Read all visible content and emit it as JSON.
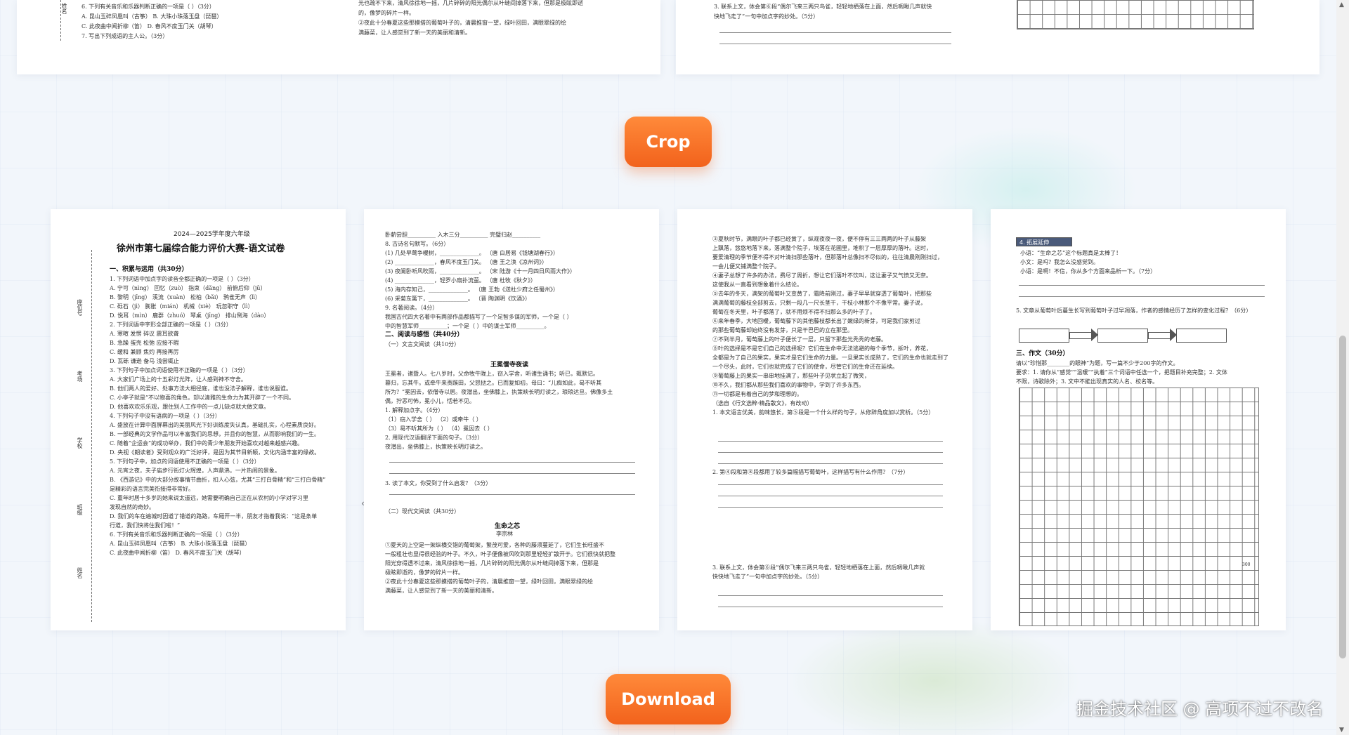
{
  "buttons": {
    "crop_label": "Crop",
    "download_label": "Download"
  },
  "watermark": "掘金技术社区 @ 高项不过不改名",
  "top_left_sheet": {
    "side_name": "姓名",
    "lines": [
      "6. 下列有关音乐和乐器判断正确的一项是（      ）（3分）",
      "A. 昆山玉碎凤凰叫（古筝）        B. 大珠小珠落玉盘（琵琶）",
      "C. 此夜曲中闻折柳（笛）          D. 春风不度玉门关（胡琴）",
      "7. 写出下列成语的主人公。（3分）"
    ],
    "right_lines": [
      "光也疏不下来，清风徐徐地一摇，几片碎碎的阳光偶尔从叶缝间掉落下来，但那是极眩即逝",
      "的，像梦的碎片一样。",
      "②夜此十分春夏这些那摸搭的葡萄叶子的，清晨推窗一望，绿叶回田，满眼翠绿的绘",
      "满藤菜，让人感觉到了新一天的美丽和清新。"
    ]
  },
  "top_right_sheet": {
    "lines": [
      "3. 联系上文，体会第⑥段“偶尔飞来三两只鸟雀，轻轻地栖落在上面，然后啁啾几声就快",
      "快地飞走了”一句中加点字的妙处。（5分）"
    ]
  },
  "page1": {
    "subtitle": "2024—2025学年度六年级",
    "title": "徐州市第七届综合能力评价大赛-语文试卷",
    "section1": "一、积累与运用（共30分）",
    "side_labels": [
      "座位号",
      "考场",
      "学校",
      "班级",
      "姓名"
    ],
    "lines": [
      "1. 下列词语中加点字的读音全都正确的一项是（      ）（3分）",
      "A. 宁可（nìng）    回忆（zuò）    指束（dǎng）   前俯后仰（jū）",
      "B. 黎明（jīng）    溪流（xuàn）    松柏（bǎi）    鸦雀无声（lì）",
      "C. 砾石（jì）      膨胀（mián）   机械（xiè）    玩忽职守（lì）",
      "D. 悦耳（mìn）     鹿群（zhuó）   琴桌（jīng）   排山倒海（dào）",
      "2. 下列词语中字形全部正确的一项是（      ）（3分）",
      "A. 寒暄        发愣        碎议        震耳欲聋",
      "B. 急躁        蛋壳        松弛        应接不暇",
      "C. 缓和        兼顾        焦灼        再接再厉",
      "D. 瓦砾        谦逊        备马        浅尝辄止",
      "3. 下列句子中加点词语使用不正确的一项是（      ）（3分）",
      "A. 大家们广场上的十五彩灯光阵，让人感到神不守舍。",
      "B. 他们两人的爱好、处事方法大相径庭，谁也没法子解释，谁也说服谁。",
      "C. 小亭子就是“不以物喜的角色，却以清雅的生命力为其开辟了一个不同。",
      "D. 他喜欢欢乐乐观，跟住别人工作中的一点儿缺点就大做文章。",
      "4. 下列句子中没有语病的一项是（      ）（3分）",
      "A. 盛放在计算中面屏幕出的美丽风光下好训练度失认真，基础扎实，心程素质良好。",
      "B. 一部经典的文学作品可以丰富我们的思想，并且你的智慧，从而影响我们的一生。",
      "C. 随着“企运会”的成功举办，我们中的青少年朋友开始喜欢对越来越感兴趣。",
      "D. 央视《朗读者》受到观众的广泛好评，是因为其节目新颖，文化内涵丰富的缘故。",
      "5. 下列句子中，加点的词语使用不正确的一项是（      ）（3分）",
      "A. 元宵之夜，夫子庙步行街灯火辉煌，人声鼎沸，一片热闹的景象。",
      "B. 《西游记》中的大部分故事情节曲折，扣人心弦，尤其“三打白骨精”和“三打白骨精”",
      "   是精彩的语言完美衔接得非常好。",
      "C. 重年时居十多岁的她来说太遥远，她需要明确自己正在从农村的小学对学习里",
      "   发现自然的奇妙。",
      "D. 我们的车在遍城时因道了错道的路路，车厢开一半，朋友才指着我说：“这是条单",
      "   行道，我们快将住我们啦！”",
      "6. 下列有关音乐和乐器判断正确的一项是（      ）（3分）",
      "A. 昆山玉碎凤凰叫（古筝）        B. 大珠小珠落玉盘（琵琶）",
      "C. 此夜曲中闻折柳（笛）          D. 春风不度玉门关（胡琴）",
      "7. 写出下列成语的主人公。（3分）"
    ]
  },
  "page2": {
    "header_line": "卧薪尝胆__________    入木三分__________    完璧归赵__________",
    "lines": [
      "8. 古诗名句默写。（6分）",
      "(1) 几处早莺争暖树，______________。    （唐 白居易《钱塘湖春行》）",
      "(2) ______________，春风不度玉门关。   （唐 王之涣《凉州词》）",
      "(3) 夜阑卧听风吹雨，______________。    （宋 陆游《十一月四日风雨大作》）",
      "(4) ______________，轻罗小扇扑流萤。   （唐 杜牧《秋夕》）",
      "(5) 海内存知己，______________。        （唐 王勃《送杜少府之任蜀州》）",
      "(6) 采菊东篱下，______________。        （晋 陶渊明《饮酒》）",
      "9. 名著阅读。（4分）",
      "我国古代四大名著中有两部作品都描写了一个足智多谋的军师，一个是（          ）",
      "中的智慧军师__________；一个是（          ）中的谋士军师__________。"
    ],
    "section2": "二、阅读与感悟（共40分）",
    "sub1": "（一）文言文阅读（共10分）",
    "story_title": "王冕僧寺夜读",
    "story_lines": [
      "王冕者，诸暨人。七八岁时，父命牧牛陇上，窃入学舍，听诸生诵书；听已，辄默记。",
      "暮归，忘其牛。或牵牛来责蹊田，父怒挞之。已而复如初。母曰：“儿痴如此，曷不听其",
      "所为？”冕因去，依僧寺以居。夜潜出，坐佛膝上，执策映长明灯读之，琅琅达旦。佛像多土",
      "偶，狞恶可怖，冕小儿，恬若不见。"
    ],
    "q_lines": [
      "1. 解释加点字。（4分）",
      "（1）窃入学舍（          ）       （2）或牵牛（          ）",
      "（3）曷不听其所为（          ）    （4）冕因去（          ）",
      "2. 用现代汉语翻译下面的句子。（3分）",
      "夜潜出，坐佛膝上，执策映长明灯读之。",
      "3. 读了本文，你受到了什么启发？（3分）"
    ],
    "sub2": "（二）现代文阅读（共30分）",
    "story2_title": "生命之芯",
    "story2_author": "李宗林",
    "story2_lines": [
      "①夏天的上空是一架纵横交错的葡萄架，繁茂可爱，各种的藤须蔓延了，它们生长旺盛不",
      "一般粗壮也显得很经验的叶子。不久，叶子便像被风吹到那里轻轻扩散开于。它们很快就把整",
      "阳光穿得透不过来，清风徐徐地一摇，几片碎碎的阳光偶尔从叶缝间掉落下来，但那是",
      "极眩即逝的，像梦的碎片一样。",
      "②夜此十分春夏这些那摸搭的葡萄叶子的，清晨推窗一望，绿叶回田，满眼翠绿的绘",
      "满藤菜，让人感觉到了新一天的美丽和清新。"
    ]
  },
  "page3": {
    "lines": [
      "③夏秋时节，满眼的叶子都已经黄了，纵观夜夜一夜，便不停有三三两两的叶子从藤架",
      "上飘落，悠悠地落下来，落满整个院子，埃落在花圃里，堆积了一层厚厚的落叶。这时，",
      "要爱清理的季节便不得不对叶清扫那些落叶，但那落叶总像扫不尽似的，往往清晨刚刚扫过，",
      "一会儿便又铺满整个院子。",
      "④妻子总想了许多的办法，费尽了周折，想让它们落叶不饮叫，这让妻子又气愤又无奈。",
      "这使我从一直看到想象着什么结论。",
      "⑤去年的冬天，满架的葡萄叶又变黄了，霜降前刚过，妻子早早就穿透了葡萄叶，把那些",
      "满满葡萄的藤枝全部剪去，只剩一段几一尺长茎干，干枝小林那个不像平常。妻子说，",
      "葡萄在冬天里，叶子都落了，就不用烦不得不扫那么多的叶子了。",
      "⑥来年春季，大地回暖，葡萄藤下的其他藤枝都长出了嫩绿的新芽，可是我们家剪过",
      "的那些葡萄藤却始终没有发芽，只是干巴巴的立在那里。",
      "⑦不到半月，葡萄藤上的叶子便长了一层，只留下那些光秃秃的老藤。",
      "⑧叶的选择是不是它们自己的选择呢？它们在生命中无法逃避的每个季节，拆叶，养花，",
      "全都是为了自己的果实，果实才是它们生命的力量。一旦果实长成熟了，它们的生命也就走到了",
      "一个尽头，此时，它们也就完成了它们的使命，尽管它们的生命还在延续。",
      "⑨葡萄藤上的果实一串串地挂满了，那些叶子见状立起了微笑，",
      "⑩不久，我们都从那些我们喜欢的事物中，学到了许多东西。",
      "⑪一切都是有着自己的梦和理想的。"
    ],
    "source": "（选自《行文选粹·精品散文》，有改动）",
    "q_lines": [
      "1. 本文语言优美，韵味悠长，第⑤段是一个什么样的句子，从修辞角度加以赏析。（5分）",
      "2. 第④段和第⑧段都用了较多篇幅描写葡萄叶，这样描写有什么作用？（7分）",
      "3. 联系上文，体会第⑥段“偶尔飞来三两只鸟雀，轻轻地栖落在上面，然后啁啾几声就",
      "   快快地飞走了”一句中加点字的妙处。（5分）"
    ]
  },
  "page4": {
    "tag": "4. 拓展延伸",
    "lines": [
      "小语：“生命之芯”这个标题真是太棒了！",
      "小文：是吗？我怎么没感觉到。",
      "小语：是啊！不信，你从多个方面来品析一下。（7分）"
    ],
    "q5": "5. 文章从葡萄叶后蔓生长写到葡萄叶子过早凋落，作者的感情经历了怎样的变化过程？（6分）",
    "section3": "三、作文（30分）",
    "essay_lines": [
      "请以“珍惜那________的眼神”为题，写一篇不少于200字的作文。",
      "要求：1. 请你从“感觉”“温暖”“执着”三个词语中任选一个，把题目补充完整；2. 文体",
      "不限，诗歌除外；3. 文中不能出现真实的人名、校名等。"
    ],
    "grid_mark": "300"
  }
}
